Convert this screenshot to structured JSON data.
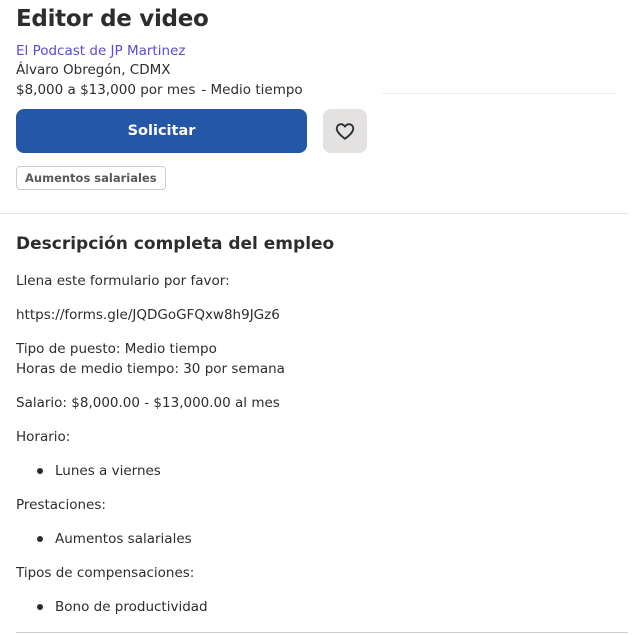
{
  "job": {
    "title": "Editor de video",
    "company": "El Podcast de JP Martinez",
    "location": "Álvaro Obregón, CDMX",
    "salary": "$8,000 a $13,000 por mes",
    "job_type": "- Medio tiempo"
  },
  "actions": {
    "apply_label": "Solicitar",
    "save_icon": "heart-icon"
  },
  "benefit_tag": "Aumentos salariales",
  "description": {
    "heading": "Descripción completa del empleo",
    "intro": "Llena este formulario por favor:",
    "link": "https://forms.gle/JQDGoGFQxw8h9JGz6",
    "job_type_line": "Tipo de puesto: Medio tiempo",
    "hours_line": "Horas de medio tiempo: 30 por semana",
    "salary_line": "Salario: $8,000.00 - $13,000.00 al mes",
    "schedule_label": "Horario:",
    "schedule_items": [
      "Lunes a viernes"
    ],
    "benefits_label": "Prestaciones:",
    "benefits_items": [
      "Aumentos salariales"
    ],
    "compensation_label": "Tipos de compensaciones:",
    "compensation_items": [
      "Bono de productividad"
    ]
  },
  "colors": {
    "apply_button": "#2557a7",
    "company_link": "#5b4bd3",
    "save_button": "#e4e2e0"
  }
}
